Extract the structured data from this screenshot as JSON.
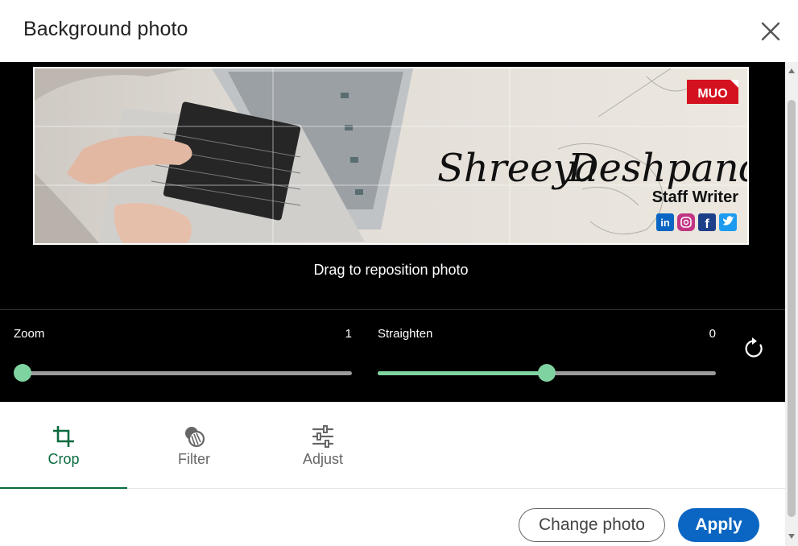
{
  "header": {
    "title": "Background photo",
    "close_icon": "close-icon"
  },
  "editor": {
    "drag_hint": "Drag to reposition photo",
    "banner": {
      "name_first": "Shreeya",
      "name_last": "Deshpande",
      "role": "Staff Writer",
      "brand": "MUO",
      "social": [
        "in",
        "ig",
        "f",
        "tw"
      ]
    },
    "zoom": {
      "label": "Zoom",
      "value": "1",
      "fraction": 0.0
    },
    "straighten": {
      "label": "Straighten",
      "value": "0",
      "fraction": 0.5
    },
    "reset_icon": "rotate-reset-icon"
  },
  "tabs": [
    {
      "label": "Crop",
      "icon": "crop-icon",
      "active": true
    },
    {
      "label": "Filter",
      "icon": "filter-icon",
      "active": false
    },
    {
      "label": "Adjust",
      "icon": "adjust-sliders-icon",
      "active": false
    }
  ],
  "footer": {
    "change_label": "Change photo",
    "apply_label": "Apply"
  },
  "colors": {
    "accent_green": "#7fd3a0",
    "tab_active": "#0a6a3f",
    "primary_blue": "#0a66c2"
  }
}
